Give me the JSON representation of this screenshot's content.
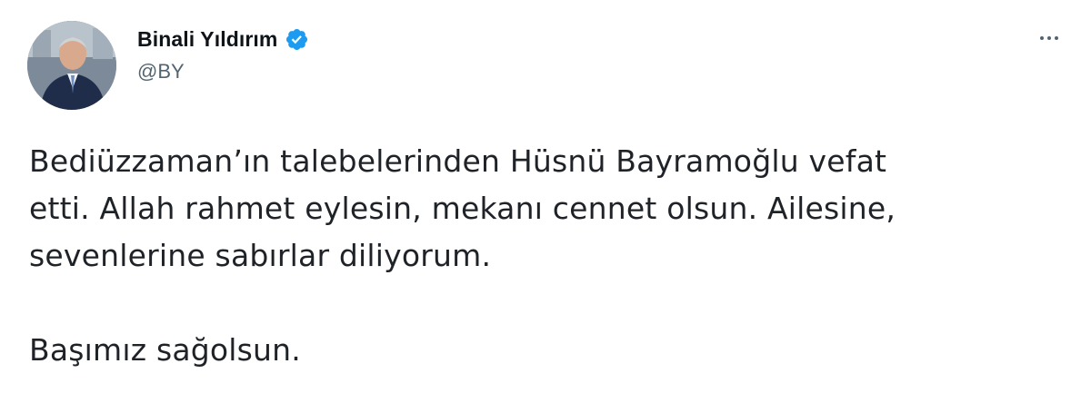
{
  "author": {
    "display_name": "Binali Yıldırım",
    "handle": "@BY",
    "verified": true,
    "avatar_icon": "profile-photo",
    "verified_icon": "verified-badge-icon",
    "accent_color": "#1d9bf0"
  },
  "menu": {
    "icon": "more-horizontal-icon"
  },
  "tweet": {
    "paragraph_1_line_1": "Bediüzzaman’ın talebelerinden Hüsnü Bayramoğlu vefat",
    "paragraph_1_line_2": "etti. Allah rahmet eylesin, mekanı cennet olsun. Ailesine,",
    "paragraph_1_line_3": "sevenlerine sabırlar diliyorum.",
    "paragraph_2": "Başımız sağolsun."
  }
}
